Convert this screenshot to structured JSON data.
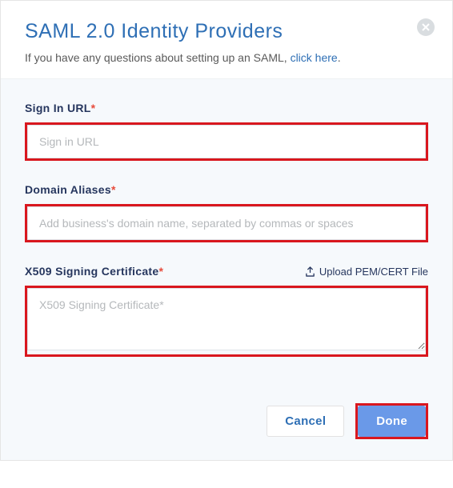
{
  "header": {
    "title": "SAML 2.0 Identity Providers",
    "subtitle_prefix": "If you have any questions about setting up an SAML, ",
    "subtitle_link": "click here",
    "subtitle_suffix": "."
  },
  "form": {
    "sign_in_url": {
      "label": "Sign In URL",
      "placeholder": "Sign in URL",
      "value": ""
    },
    "domain_aliases": {
      "label": "Domain Aliases",
      "placeholder": "Add business's domain name, separated by commas or spaces",
      "value": ""
    },
    "x509": {
      "label": "X509 Signing Certificate",
      "upload_label": "Upload PEM/CERT File",
      "placeholder": "X509 Signing Certificate*",
      "value": ""
    }
  },
  "footer": {
    "cancel": "Cancel",
    "done": "Done"
  },
  "icons": {
    "close": "close-icon",
    "upload": "upload-icon"
  }
}
